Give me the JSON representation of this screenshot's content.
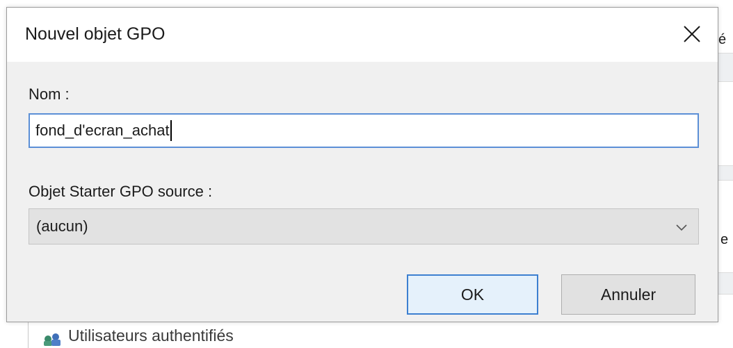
{
  "dialog": {
    "title": "Nouvel objet GPO",
    "name_label": "Nom :",
    "name_value": "fond_d'ecran_achat",
    "starter_label": "Objet Starter GPO source :",
    "starter_value": "(aucun)",
    "ok_label": "OK",
    "cancel_label": "Annuler"
  },
  "background": {
    "right_glyph_top": "é",
    "right_glyph_mid": "e",
    "bottom_row_text": "Utilisateurs authentifiés"
  },
  "icons": {
    "close": "close-icon",
    "dropdown": "chevron-down-icon",
    "users": "users-group-icon"
  },
  "colors": {
    "focus_border": "#5b8fd6",
    "default_button_border": "#3c7fd0",
    "dialog_bg": "#f0f0f0"
  }
}
